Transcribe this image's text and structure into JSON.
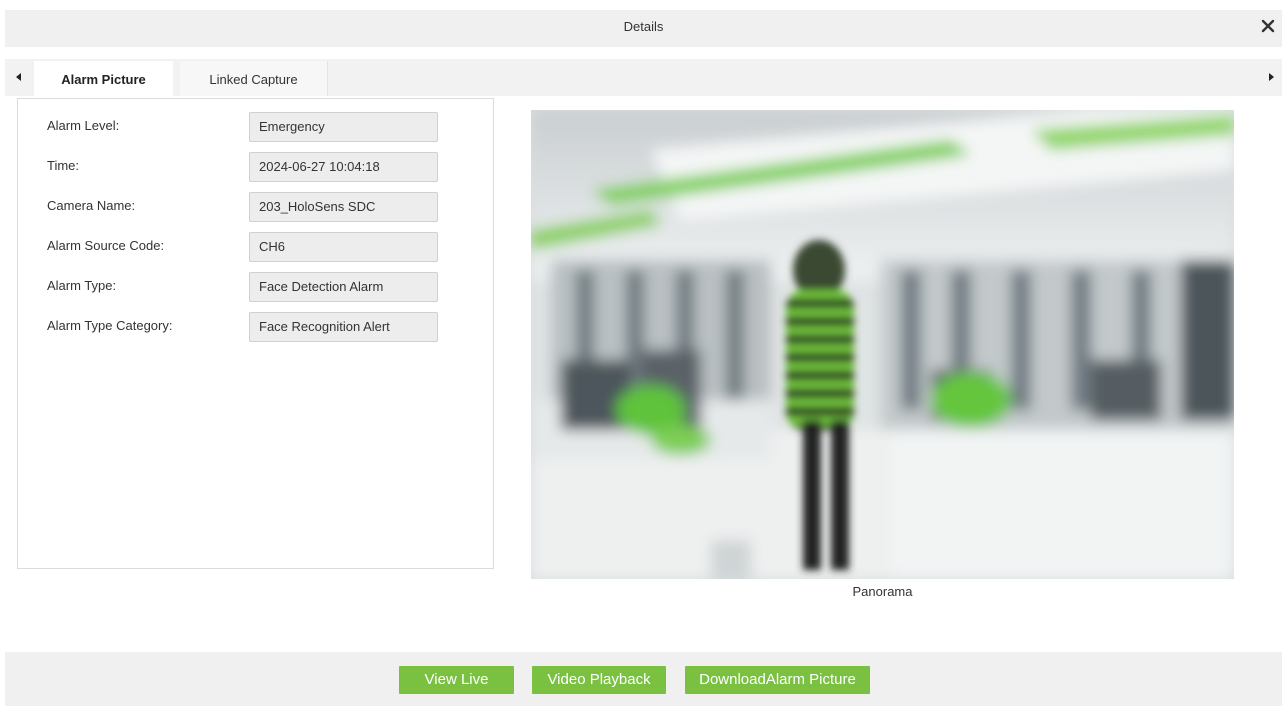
{
  "dialog": {
    "title": "Details",
    "close_icon": "close-icon"
  },
  "tabs": [
    {
      "label": "Alarm Picture",
      "active": true
    },
    {
      "label": "Linked Capture",
      "active": false
    }
  ],
  "fields": [
    {
      "label": "Alarm Level:",
      "value": "Emergency"
    },
    {
      "label": "Time:",
      "value": "2024-06-27 10:04:18"
    },
    {
      "label": "Camera Name:",
      "value": "203_HoloSens SDC"
    },
    {
      "label": "Alarm Source Code:",
      "value": "CH6"
    },
    {
      "label": "Alarm Type:",
      "value": "Face Detection Alarm"
    },
    {
      "label": "Alarm Type Category:",
      "value": "Face Recognition Alert"
    }
  ],
  "picture": {
    "caption": "Panorama"
  },
  "buttons": {
    "view_live": "View Live",
    "video_playback": "Video Playback",
    "download": "DownloadAlarm Picture"
  },
  "colors": {
    "accent_green": "#7ac142"
  }
}
